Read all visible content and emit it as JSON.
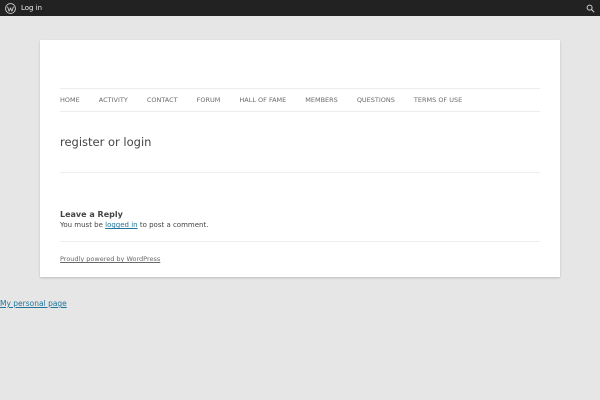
{
  "adminbar": {
    "logo_icon": "wordpress-icon",
    "login_label": "Log in",
    "search_icon": "search-icon"
  },
  "nav": {
    "items": [
      {
        "label": "HOME"
      },
      {
        "label": "ACTIVITY"
      },
      {
        "label": "CONTACT"
      },
      {
        "label": "FORUM"
      },
      {
        "label": "HALL OF FAME"
      },
      {
        "label": "MEMBERS"
      },
      {
        "label": "QUESTIONS"
      },
      {
        "label": "TERMS OF USE"
      }
    ]
  },
  "main": {
    "title": "register or login"
  },
  "comments": {
    "reply_title": "Leave a Reply",
    "must_prefix": "You must be ",
    "login_link": "logged in",
    "must_suffix": " to post a comment."
  },
  "footer": {
    "credit": "Proudly powered by WordPress"
  },
  "outside": {
    "personal_link": "My personal page"
  },
  "colors": {
    "adminbar_bg": "#222222",
    "page_bg": "#e6e6e6",
    "link": "#21759b"
  }
}
